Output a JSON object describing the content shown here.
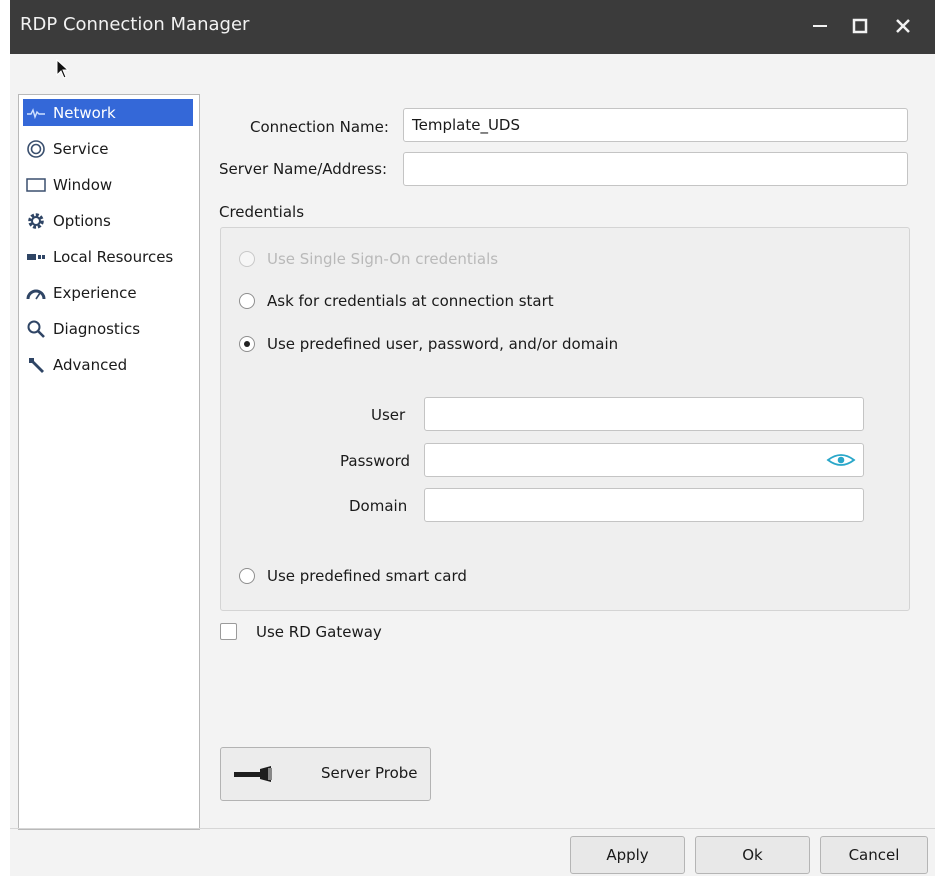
{
  "window": {
    "title": "RDP Connection Manager"
  },
  "sidebar": {
    "items": [
      {
        "label": "Network",
        "icon": "network-icon"
      },
      {
        "label": "Service",
        "icon": "service-icon"
      },
      {
        "label": "Window",
        "icon": "window-icon"
      },
      {
        "label": "Options",
        "icon": "gear-icon"
      },
      {
        "label": "Local Resources",
        "icon": "local-resources-icon"
      },
      {
        "label": "Experience",
        "icon": "speedometer-icon"
      },
      {
        "label": "Diagnostics",
        "icon": "search-icon"
      },
      {
        "label": "Advanced",
        "icon": "wrench-icon"
      }
    ],
    "selected": "Network"
  },
  "form": {
    "connection_name_label": "Connection Name:",
    "connection_name_value": "Template_UDS",
    "server_label": "Server Name/Address:",
    "server_value": "",
    "credentials_label": "Credentials"
  },
  "credentials": {
    "options": [
      {
        "label": "Use Single Sign-On credentials",
        "state": "disabled"
      },
      {
        "label": "Ask for credentials at connection start",
        "state": "unchecked"
      },
      {
        "label": "Use predefined user, password, and/or domain",
        "state": "checked"
      },
      {
        "label": "Use predefined smart card",
        "state": "unchecked"
      }
    ],
    "user_label": "User",
    "user_value": "",
    "password_label": "Password",
    "password_value": "",
    "domain_label": "Domain",
    "domain_value": ""
  },
  "gateway": {
    "label": "Use RD Gateway",
    "checked": false
  },
  "probe": {
    "label": "Server Probe"
  },
  "buttons": {
    "apply": "Apply",
    "ok": "Ok",
    "cancel": "Cancel"
  },
  "colors": {
    "titlebar": "#3b3b3b",
    "selection": "#3468d8",
    "eye_icon": "#2aa7c9"
  }
}
